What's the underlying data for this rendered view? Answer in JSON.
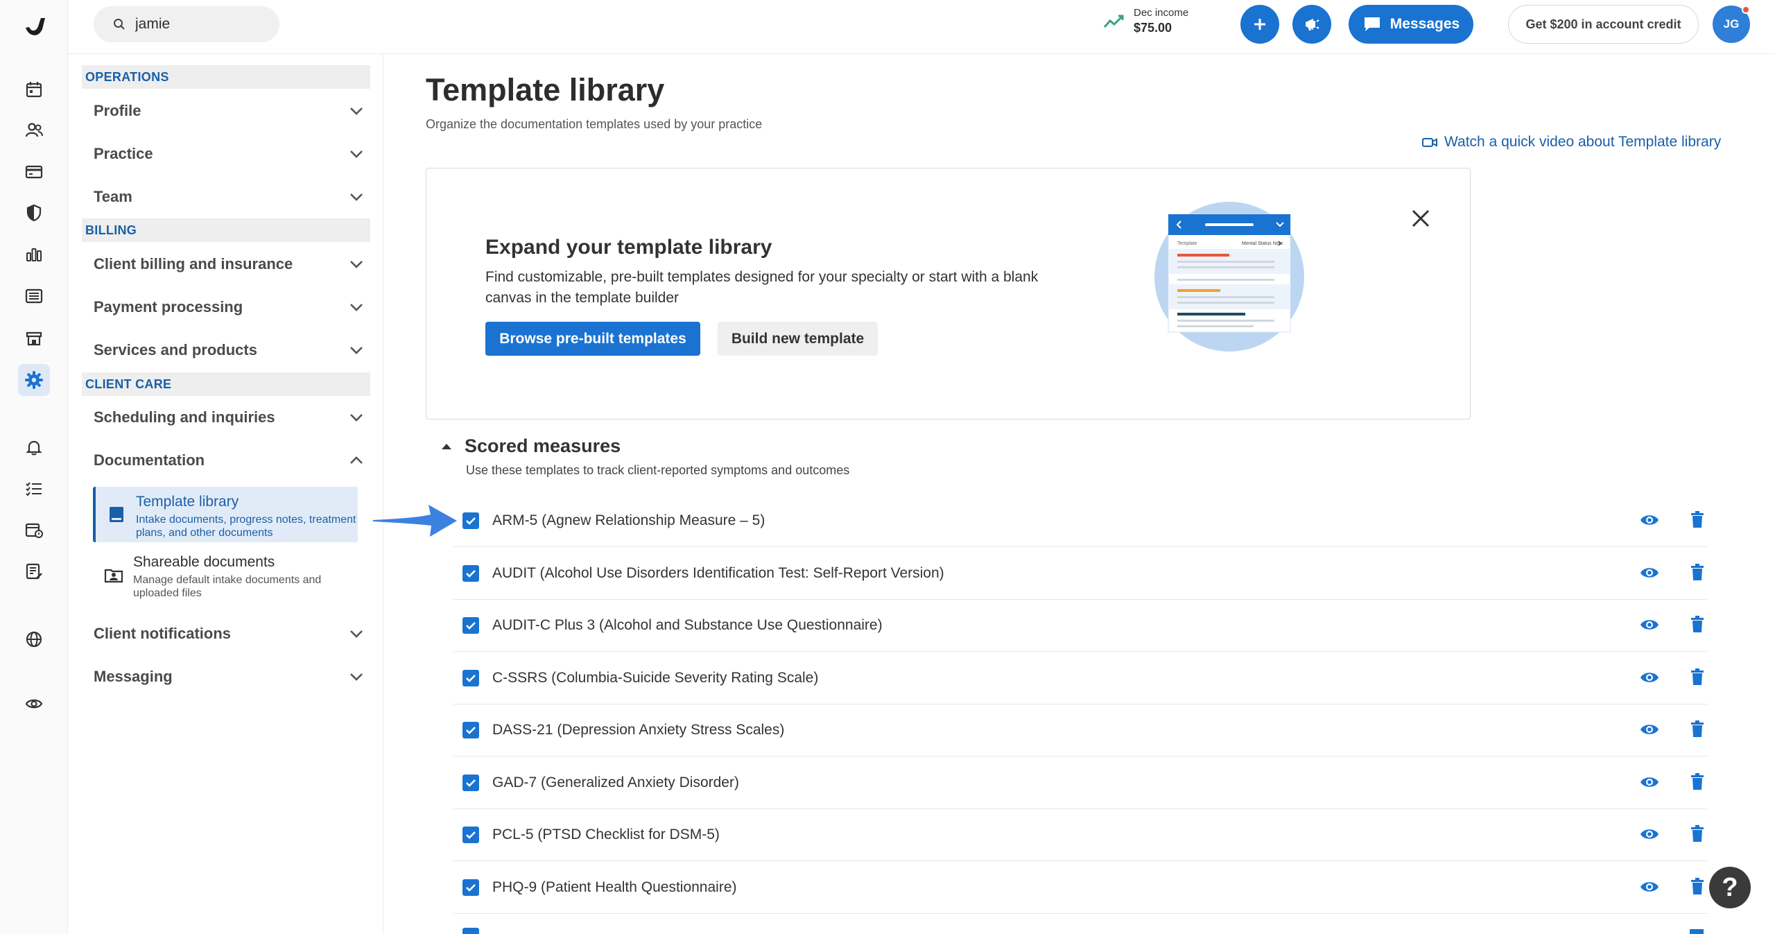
{
  "topbar": {
    "search_value": "jamie",
    "income_label": "Dec income",
    "income_value": "$75.00",
    "messages_label": "Messages",
    "credit_label": "Get $200 in account credit",
    "avatar_initials": "JG"
  },
  "rail": {
    "icons": [
      "calendar-icon",
      "clients-icon",
      "billing-card-icon",
      "shield-icon",
      "analytics-icon",
      "list-icon",
      "marketplace-icon",
      "settings-gear-icon",
      "bell-icon",
      "tasks-icon",
      "appointment-icon",
      "notes-icon",
      "globe-icon",
      "eye-icon"
    ],
    "active": "settings-gear-icon"
  },
  "sidebar": {
    "operations_header": "OPERATIONS",
    "profile": "Profile",
    "practice": "Practice",
    "team": "Team",
    "billing_header": "BILLING",
    "client_billing": "Client billing and insurance",
    "payment_processing": "Payment processing",
    "services_products": "Services and products",
    "client_care_header": "CLIENT CARE",
    "scheduling": "Scheduling and inquiries",
    "documentation": "Documentation",
    "template_library_title": "Template library",
    "template_library_desc": "Intake documents, progress notes, treatment plans, and other documents",
    "shareable_title": "Shareable documents",
    "shareable_desc": "Manage default intake documents and uploaded files",
    "client_notifications": "Client notifications",
    "messaging": "Messaging"
  },
  "main": {
    "title": "Template library",
    "subtitle": "Organize the documentation templates used by your practice",
    "video_link": "Watch a quick video about Template library",
    "card": {
      "title": "Expand your template library",
      "desc": "Find customizable, pre-built templates designed for your specialty or start with a blank canvas in the template builder",
      "browse_label": "Browse pre-built templates",
      "build_label": "Build new template",
      "illus_col1": "Template",
      "illus_col2": "Mental Status Note"
    },
    "scored": {
      "title": "Scored measures",
      "subtitle": "Use these templates to track client-reported symptoms and outcomes",
      "items": [
        "ARM-5 (Agnew Relationship Measure – 5)",
        "AUDIT (Alcohol Use Disorders Identification Test: Self-Report Version)",
        "AUDIT-C Plus 3 (Alcohol and Substance Use Questionnaire)",
        "C-SSRS (Columbia-Suicide Severity Rating Scale)",
        "DASS-21 (Depression Anxiety Stress Scales)",
        "GAD-7 (Generalized Anxiety Disorder)",
        "PCL-5 (PTSD Checklist for DSM-5)",
        "PHQ-9 (Patient Health Questionnaire)"
      ]
    }
  },
  "help_label": "?",
  "colors": {
    "accent": "#1a73d1",
    "accent_dark": "#1a5fa8",
    "badge": "#e8563b"
  }
}
